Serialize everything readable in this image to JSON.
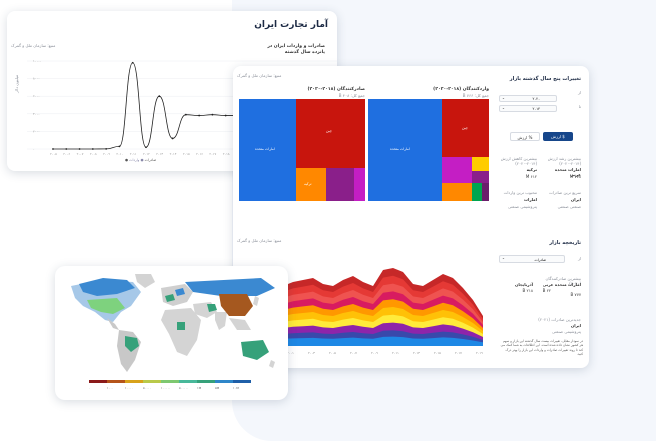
{
  "back_card": {
    "title": "آمار تجارت ایران",
    "chart_title": "صادرات و واردات ایران در پانزده سال گذشته",
    "source": "منبع: سازمان ملل و گمرک",
    "ylabel": "میلیون دلار",
    "legend": [
      "صادرات",
      "واردات"
    ],
    "xticks": [
      "۲۰۰۵",
      "۲۰۰۶",
      "۲۰۰۷",
      "۲۰۰۸",
      "۲۰۰۹",
      "۲۰۱۰",
      "۲۰۱۱",
      "۲۰۱۲",
      "۲۰۱۳",
      "۲۰۱۴",
      "۲۰۱۵",
      "۲۰۱۶",
      "۲۰۱۷",
      "۲۰۱۸",
      "۲۰۱۹"
    ],
    "yticks": [
      "۱۰۰۰۰",
      "۸۰۰۰",
      "۶۰۰۰",
      "۴۰۰۰",
      "۲۰۰۰",
      "۰"
    ]
  },
  "chart_data": {
    "type": "line",
    "x": [
      "۲۰۰۵",
      "۲۰۰۶",
      "۲۰۰۷",
      "۲۰۰۸",
      "۲۰۰۹",
      "۲۰۱۰",
      "۲۰۱۱",
      "۲۰۱۲",
      "۲۰۱۳",
      "۲۰۱۴",
      "۲۰۱۵",
      "۲۰۱۶",
      "۲۰۱۷",
      "۲۰۱۸",
      "۲۰۱۹"
    ],
    "series": [
      {
        "name": "صادرات",
        "values": [
          0,
          0,
          0,
          0,
          10,
          300,
          9800,
          200,
          6000,
          1200,
          3900,
          3800,
          3900,
          3800,
          3800
        ]
      }
    ],
    "ylim": [
      0,
      10000
    ]
  },
  "main": {
    "treemap_source": "منبع: سازمان ملل و گمرک",
    "import_title": "واردکنندگان (۲۰۱۸-۲۰۲۰)",
    "import_sub": "جمع کل: ۷۶۶ B",
    "export_title": "صادرکنندگان (۲۰۱۸-۲۰۲۰)",
    "export_sub": "جمع کل: ۴۰۸ B",
    "import_cells": [
      {
        "label": "امارات متحده",
        "color": "#1f6fe0"
      },
      {
        "label": "چین",
        "color": "#c8150d"
      },
      {
        "label": "",
        "color": "#c41ec4"
      },
      {
        "label": "",
        "color": "#ffcc00"
      },
      {
        "label": "",
        "color": "#8a1f8a"
      },
      {
        "label": "",
        "color": "#ff8800"
      },
      {
        "label": "",
        "color": "#00a550"
      },
      {
        "label": "",
        "color": "#6b1e6b"
      }
    ],
    "export_cells": [
      {
        "label": "امارات متحده",
        "color": "#1f6fe0"
      },
      {
        "label": "چین",
        "color": "#c8150d"
      },
      {
        "label": "ترکیه",
        "color": "#ff8800"
      },
      {
        "label": "",
        "color": "#8a1f8a"
      },
      {
        "label": "",
        "color": "#c41ec4"
      }
    ],
    "panel_title": "تغییرات پنج سال گذشته بازار",
    "from_label": "از",
    "to_label": "تا",
    "from_value": "۲۰۲۰",
    "to_value": "۲۰۱۴",
    "tab_export": "ارزش $",
    "tab_import": "ارزش %",
    "stat1_title": "بیشترین رشد ارزش (۲۰۱۴-۲۰۲۰)",
    "stat1_value": "امارات متحده عربی",
    "stat1_sub": "۷۷۸ M",
    "stat2_title": "بیشترین کاهش ارزش (۲۰۱۴-۲۰۲۰)",
    "stat2_value": "ترکیه",
    "stat2_sub": "۶۱۲ M",
    "stat3_title": "سریع ترین صادرات",
    "stat3_value": "ایران",
    "stat3_sub": "صنعتی صنعتی",
    "stat4_title": "محبوب ترین واردات",
    "stat4_value": "امارات",
    "stat4_sub": "پتروشیمی صنعتی",
    "history_title": "تاریخچه بازار",
    "history_select": "صادرات",
    "history_from": "از",
    "hist_rank_title": "بیشترین صادرکنندگان (۲۰۲۰)",
    "hist_rank1": "امارات متحده عربی",
    "hist_rank1_val": "۲۲ B",
    "hist_rank2": "آذربایجان",
    "hist_rank2_val": "۲۱۸ B",
    "hist_rank3": "۷۷۷ B",
    "hist_new_title": "جدیدترین صادرات (۲۰۲۱)",
    "hist_new_value": "ایران",
    "hist_new_sub": "پتروشیمی صنعتی",
    "hist_note": "در نمودار مقابل، تغییرات بیست سال گذشته این بازار و سهم هر کشور نشان داده شده است. این اطلاعات به شما کمک می کند تا روند تغییرات صادرات و واردات این بازار را بهتر درک کنید.",
    "area_source": "منبع: سازمان ملل و گمرک",
    "area_xticks": [
      "۲۰۰۱",
      "۲۰۰۳",
      "۲۰۰۵",
      "۲۰۰۷",
      "۲۰۰۹",
      "۲۰۱۱",
      "۲۰۱۳",
      "۲۰۱۵",
      "۲۰۱۷",
      "۲۰۱۹"
    ]
  },
  "map": {
    "legend": [
      "۰",
      "۱۰۰۰",
      "۱۰۰۰۰",
      "۵۰۰۰۰",
      "۱۰۰۰۰۰",
      "۵۰۰۰۰۰",
      "۱M",
      "۵M",
      "۱۰M"
    ]
  }
}
